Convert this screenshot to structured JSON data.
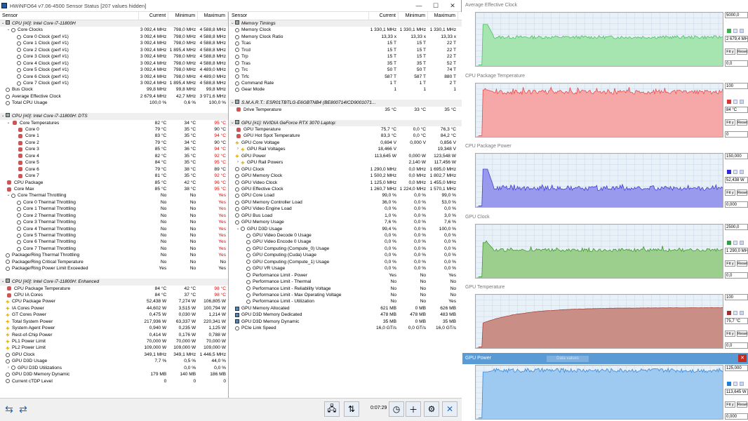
{
  "window": {
    "title": "HWiNFO64 v7.06-4500 Sensor Status [207 values hidden]",
    "minimize": "—",
    "maximize": "☐",
    "close": "✕"
  },
  "columns": {
    "sensor": "Sensor",
    "current": "Current",
    "minimum": "Minimum",
    "maximum": "Maximum"
  },
  "left_rows": [
    {
      "type": "group",
      "name": "CPU [#0]: Intel Core i7-11800H"
    },
    {
      "name": "Core Clocks",
      "icon": "clock",
      "exp": "⌄",
      "indent": 1,
      "cur": "3 092,4 MHz",
      "min": "798,0 MHz",
      "max": "4 588,8 MHz"
    },
    {
      "name": "Core 0 Clock (perf #1)",
      "icon": "clock",
      "indent": 2,
      "cur": "3 092,4 MHz",
      "min": "798,0 MHz",
      "max": "4 588,8 MHz"
    },
    {
      "name": "Core 1 Clock (perf #1)",
      "icon": "clock",
      "indent": 2,
      "cur": "3 092,4 MHz",
      "min": "798,0 MHz",
      "max": "4 588,8 MHz"
    },
    {
      "name": "Core 2 Clock (perf #1)",
      "icon": "clock",
      "indent": 2,
      "cur": "3 092,4 MHz",
      "min": "1 895,4 MHz",
      "max": "4 588,8 MHz"
    },
    {
      "name": "Core 3 Clock (perf #1)",
      "icon": "clock",
      "indent": 2,
      "cur": "3 092,4 MHz",
      "min": "798,0 MHz",
      "max": "4 588,8 MHz"
    },
    {
      "name": "Core 4 Clock (perf #1)",
      "icon": "clock",
      "indent": 2,
      "cur": "3 092,4 MHz",
      "min": "798,0 MHz",
      "max": "4 588,8 MHz"
    },
    {
      "name": "Core 5 Clock (perf #1)",
      "icon": "clock",
      "indent": 2,
      "cur": "3 092,4 MHz",
      "min": "798,0 MHz",
      "max": "4 489,0 MHz"
    },
    {
      "name": "Core 6 Clock (perf #1)",
      "icon": "clock",
      "indent": 2,
      "cur": "3 092,4 MHz",
      "min": "798,0 MHz",
      "max": "4 489,0 MHz"
    },
    {
      "name": "Core 7 Clock (perf #1)",
      "icon": "clock",
      "indent": 2,
      "cur": "3 092,4 MHz",
      "min": "1 895,4 MHz",
      "max": "4 588,8 MHz"
    },
    {
      "name": "Bus Clock",
      "icon": "clock",
      "indent": 0,
      "cur": "99,8 MHz",
      "min": "99,8 MHz",
      "max": "99,8 MHz"
    },
    {
      "name": "Average Effective Clock",
      "icon": "clock",
      "indent": 0,
      "cur": "2 679,4 MHz",
      "min": "42,7 MHz",
      "max": "3 971,6 MHz"
    },
    {
      "name": "Total CPU Usage",
      "icon": "clock",
      "indent": 0,
      "cur": "100,0 %",
      "min": "0,6 %",
      "max": "100,0 %"
    },
    {
      "type": "spacer"
    },
    {
      "type": "group",
      "name": "CPU [#0]: Intel Core i7-11800H: DTS"
    },
    {
      "name": "Core Temperatures",
      "icon": "therm",
      "exp": "⌄",
      "indent": 1,
      "cur": "82 °C",
      "min": "34 °C",
      "max": "95 °C",
      "maxred": true
    },
    {
      "name": "Core 0",
      "icon": "therm",
      "indent": 2,
      "cur": "79 °C",
      "min": "35 °C",
      "max": "90 °C"
    },
    {
      "name": "Core 1",
      "icon": "therm",
      "indent": 2,
      "cur": "83 °C",
      "min": "35 °C",
      "max": "94 °C",
      "maxred": true
    },
    {
      "name": "Core 2",
      "icon": "therm",
      "indent": 2,
      "cur": "79 °C",
      "min": "34 °C",
      "max": "90 °C"
    },
    {
      "name": "Core 3",
      "icon": "therm",
      "indent": 2,
      "cur": "85 °C",
      "min": "36 °C",
      "max": "94 °C",
      "maxred": true
    },
    {
      "name": "Core 4",
      "icon": "therm",
      "indent": 2,
      "cur": "82 °C",
      "min": "35 °C",
      "max": "92 °C",
      "maxred": true
    },
    {
      "name": "Core 5",
      "icon": "therm",
      "indent": 2,
      "cur": "84 °C",
      "min": "35 °C",
      "max": "95 °C",
      "maxred": true
    },
    {
      "name": "Core 6",
      "icon": "therm",
      "indent": 2,
      "cur": "79 °C",
      "min": "38 °C",
      "max": "89 °C"
    },
    {
      "name": "Core 7",
      "icon": "therm",
      "indent": 2,
      "cur": "81 °C",
      "min": "35 °C",
      "max": "92 °C",
      "maxred": true
    },
    {
      "name": "CPU Package",
      "icon": "therm",
      "indent": 0,
      "cur": "85 °C",
      "min": "42 °C",
      "max": "96 °C",
      "maxred": true
    },
    {
      "name": "Core Max",
      "icon": "therm",
      "indent": 0,
      "cur": "85 °C",
      "min": "38 °C",
      "max": "95 °C",
      "maxred": true
    },
    {
      "name": "Core Thermal Throttling",
      "icon": "clock",
      "exp": "⌄",
      "indent": 1,
      "cur": "No",
      "min": "No",
      "max": "Yes",
      "maxred": true
    },
    {
      "name": "Core 0 Thermal Throttling",
      "icon": "clock",
      "indent": 2,
      "cur": "No",
      "min": "No",
      "max": "Yes",
      "maxred": true
    },
    {
      "name": "Core 1 Thermal Throttling",
      "icon": "clock",
      "indent": 2,
      "cur": "No",
      "min": "No",
      "max": "Yes",
      "maxred": true
    },
    {
      "name": "Core 2 Thermal Throttling",
      "icon": "clock",
      "indent": 2,
      "cur": "No",
      "min": "No",
      "max": "Yes",
      "maxred": true
    },
    {
      "name": "Core 3 Thermal Throttling",
      "icon": "clock",
      "indent": 2,
      "cur": "No",
      "min": "No",
      "max": "Yes",
      "maxred": true
    },
    {
      "name": "Core 4 Thermal Throttling",
      "icon": "clock",
      "indent": 2,
      "cur": "No",
      "min": "No",
      "max": "Yes",
      "maxred": true
    },
    {
      "name": "Core 5 Thermal Throttling",
      "icon": "clock",
      "indent": 2,
      "cur": "No",
      "min": "No",
      "max": "Yes",
      "maxred": true
    },
    {
      "name": "Core 6 Thermal Throttling",
      "icon": "clock",
      "indent": 2,
      "cur": "No",
      "min": "No",
      "max": "Yes",
      "maxred": true
    },
    {
      "name": "Core 7 Thermal Throttling",
      "icon": "clock",
      "indent": 2,
      "cur": "No",
      "min": "No",
      "max": "Yes",
      "maxred": true
    },
    {
      "name": "Package/Ring Thermal Throttling",
      "icon": "clock",
      "indent": 0,
      "cur": "No",
      "min": "No",
      "max": "Yes",
      "maxred": true
    },
    {
      "name": "Package/Ring Critical Temperature",
      "icon": "clock",
      "indent": 0,
      "cur": "No",
      "min": "No",
      "max": "No"
    },
    {
      "name": "Package/Ring Power Limit Exceeded",
      "icon": "clock",
      "indent": 0,
      "cur": "Yes",
      "min": "No",
      "max": "Yes"
    },
    {
      "type": "spacer"
    },
    {
      "type": "group",
      "name": "CPU [#0]: Intel Core i7-11800H: Enhanced"
    },
    {
      "name": "CPU Package Temperature",
      "icon": "therm",
      "indent": 0,
      "cur": "84 °C",
      "min": "42 °C",
      "max": "98 °C",
      "maxred": true
    },
    {
      "name": "CPU IA Cores",
      "icon": "therm",
      "indent": 0,
      "cur": "84 °C",
      "min": "37 °C",
      "max": "98 °C",
      "maxred": true
    },
    {
      "name": "CPU Package Power",
      "icon": "bolt",
      "indent": 0,
      "cur": "52,438 W",
      "min": "7,274 W",
      "max": "106,805 W"
    },
    {
      "name": "IA Cores Power",
      "icon": "bolt",
      "indent": 0,
      "cur": "44,602 W",
      "min": "3,515 W",
      "max": "100,794 W"
    },
    {
      "name": "GT Cores Power",
      "icon": "bolt",
      "indent": 0,
      "cur": "0,475 W",
      "min": "0,030 W",
      "max": "1,214 W"
    },
    {
      "name": "Total System Power",
      "icon": "bolt",
      "indent": 0,
      "cur": "217,936 W",
      "min": "63,337 W",
      "max": "220,341 W"
    },
    {
      "name": "System Agent Power",
      "icon": "bolt",
      "indent": 0,
      "cur": "0,940 W",
      "min": "0,235 W",
      "max": "1,125 W"
    },
    {
      "name": "Rest-of-Chip Power",
      "icon": "bolt",
      "indent": 0,
      "cur": "0,414 W",
      "min": "0,176 W",
      "max": "0,788 W"
    },
    {
      "name": "PL1 Power Limit",
      "icon": "bolt",
      "indent": 0,
      "cur": "70,000 W",
      "min": "70,000 W",
      "max": "70,000 W"
    },
    {
      "name": "PL2 Power Limit",
      "icon": "bolt",
      "indent": 0,
      "cur": "109,000 W",
      "min": "109,000 W",
      "max": "109,000 W"
    },
    {
      "name": "GPU Clock",
      "icon": "clock",
      "indent": 0,
      "cur": "349,1 MHz",
      "min": "349,1 MHz",
      "max": "1 446,5 MHz"
    },
    {
      "name": "GPU D3D Usage",
      "icon": "clock",
      "indent": 0,
      "cur": "7,7 %",
      "min": "0,5 %",
      "max": "44,0 %"
    },
    {
      "name": "GPU D3D Utilizations",
      "icon": "clock",
      "exp": "›",
      "indent": 1,
      "cur": "",
      "min": "0,0 %",
      "max": "0,0 %"
    },
    {
      "name": "GPU D3D Memory Dynamic",
      "icon": "clock",
      "indent": 0,
      "cur": "179 MB",
      "min": "140 MB",
      "max": "186 MB"
    },
    {
      "name": "Current cTDP Level",
      "icon": "clock",
      "indent": 0,
      "cur": "0",
      "min": "0",
      "max": "0"
    }
  ],
  "right_rows": [
    {
      "type": "group",
      "name": "Memory Timings"
    },
    {
      "name": "Memory Clock",
      "icon": "clock",
      "indent": 0,
      "cur": "1 330,1 MHz",
      "min": "1 330,1 MHz",
      "max": "1 330,1 MHz"
    },
    {
      "name": "Memory Clock Ratio",
      "icon": "clock",
      "indent": 0,
      "cur": "13,33 x",
      "min": "13,33 x",
      "max": "13,33 x"
    },
    {
      "name": "Tcas",
      "icon": "clock",
      "indent": 0,
      "cur": "15 T",
      "min": "15 T",
      "max": "22 T"
    },
    {
      "name": "Trcd",
      "icon": "clock",
      "indent": 0,
      "cur": "15 T",
      "min": "15 T",
      "max": "22 T"
    },
    {
      "name": "Trp",
      "icon": "clock",
      "indent": 0,
      "cur": "15 T",
      "min": "15 T",
      "max": "22 T"
    },
    {
      "name": "Tras",
      "icon": "clock",
      "indent": 0,
      "cur": "35 T",
      "min": "35 T",
      "max": "52 T"
    },
    {
      "name": "Trc",
      "icon": "clock",
      "indent": 0,
      "cur": "50 T",
      "min": "50 T",
      "max": "74 T"
    },
    {
      "name": "Trfc",
      "icon": "clock",
      "indent": 0,
      "cur": "587 T",
      "min": "587 T",
      "max": "880 T"
    },
    {
      "name": "Command Rate",
      "icon": "clock",
      "indent": 0,
      "cur": "1 T",
      "min": "1 T",
      "max": "2 T"
    },
    {
      "name": "Gear Mode",
      "icon": "clock",
      "indent": 0,
      "cur": "1",
      "min": "1",
      "max": "1"
    },
    {
      "type": "spacer"
    },
    {
      "type": "group",
      "name": "S.M.A.R.T.: ESR01TBTLG-E6GBTNB4 (BE800714ICD9001071..."
    },
    {
      "name": "Drive Temperature",
      "icon": "therm",
      "indent": 0,
      "cur": "35 °C",
      "min": "33 °C",
      "max": "35 °C"
    },
    {
      "type": "spacer"
    },
    {
      "type": "group",
      "name": "GPU [#1]: NVIDIA GeForce RTX 3070 Laptop:"
    },
    {
      "name": "GPU Temperature",
      "icon": "therm",
      "indent": 0,
      "cur": "75,7 °C",
      "min": "0,0 °C",
      "max": "76,3 °C"
    },
    {
      "name": "GPU Hot Spot Temperature",
      "icon": "therm",
      "indent": 0,
      "cur": "83,3 °C",
      "min": "0,0 °C",
      "max": "84,2 °C"
    },
    {
      "name": "GPU Core Voltage",
      "icon": "bolt",
      "indent": 0,
      "cur": "0,694 V",
      "min": "0,000 V",
      "max": "0,856 V"
    },
    {
      "name": "GPU Rail Voltages",
      "icon": "bolt",
      "exp": "›",
      "indent": 1,
      "cur": "18,466 V",
      "min": "",
      "max": "19,348 V"
    },
    {
      "name": "GPU Power",
      "icon": "bolt",
      "indent": 0,
      "cur": "113,645 W",
      "min": "0,000 W",
      "max": "123,548 W"
    },
    {
      "name": "GPU Rail Powers",
      "icon": "bolt",
      "exp": "›",
      "indent": 1,
      "cur": "",
      "min": "2,140 W",
      "max": "117,456 W"
    },
    {
      "name": "GPU Clock",
      "icon": "clock",
      "indent": 0,
      "cur": "1 290,0 MHz",
      "min": "0,0 MHz",
      "max": "1 695,0 MHz"
    },
    {
      "name": "GPU Memory Clock",
      "icon": "clock",
      "indent": 0,
      "cur": "1 500,2 MHz",
      "min": "0,0 MHz",
      "max": "1 802,7 MHz"
    },
    {
      "name": "GPU Video Clock",
      "icon": "clock",
      "indent": 0,
      "cur": "1 125,0 MHz",
      "min": "0,0 MHz",
      "max": "1 455,0 MHz"
    },
    {
      "name": "GPU Effective Clock",
      "icon": "clock",
      "indent": 0,
      "cur": "1 260,7 MHz",
      "min": "1 224,0 MHz",
      "max": "1 570,1 MHz"
    },
    {
      "name": "GPU Core Load",
      "icon": "clock",
      "indent": 0,
      "cur": "99,0 %",
      "min": "0,0 %",
      "max": "99,0 %"
    },
    {
      "name": "GPU Memory Controller Load",
      "icon": "clock",
      "indent": 0,
      "cur": "36,0 %",
      "min": "0,0 %",
      "max": "53,0 %"
    },
    {
      "name": "GPU Video Engine Load",
      "icon": "clock",
      "indent": 0,
      "cur": "0,0 %",
      "min": "0,0 %",
      "max": "0,0 %"
    },
    {
      "name": "GPU Bus Load",
      "icon": "clock",
      "indent": 0,
      "cur": "1,0 %",
      "min": "0,0 %",
      "max": "3,0 %"
    },
    {
      "name": "GPU Memory Usage",
      "icon": "clock",
      "indent": 0,
      "cur": "7,6 %",
      "min": "0,0 %",
      "max": "7,6 %"
    },
    {
      "name": "GPU D3D Usage",
      "icon": "clock",
      "exp": "⌄",
      "indent": 1,
      "cur": "99,4 %",
      "min": "0,0 %",
      "max": "100,0 %"
    },
    {
      "name": "GPU Video Decode 0 Usage",
      "icon": "clock",
      "indent": 2,
      "cur": "0,0 %",
      "min": "0,0 %",
      "max": "0,0 %"
    },
    {
      "name": "GPU Video Encode 0 Usage",
      "icon": "clock",
      "indent": 2,
      "cur": "0,0 %",
      "min": "0,0 %",
      "max": "0,0 %"
    },
    {
      "name": "GPU Computing (Compute_0) Usage",
      "icon": "clock",
      "indent": 2,
      "cur": "0,0 %",
      "min": "0,0 %",
      "max": "0,0 %"
    },
    {
      "name": "GPU Computing (Cuda) Usage",
      "icon": "clock",
      "indent": 2,
      "cur": "0,0 %",
      "min": "0,0 %",
      "max": "0,0 %"
    },
    {
      "name": "GPU Computing (Compute_1) Usage",
      "icon": "clock",
      "indent": 2,
      "cur": "0,0 %",
      "min": "0,0 %",
      "max": "0,0 %"
    },
    {
      "name": "GPU VR Usage",
      "icon": "clock",
      "indent": 2,
      "cur": "0,0 %",
      "min": "0,0 %",
      "max": "0,0 %"
    },
    {
      "name": "Performance Limit - Power",
      "icon": "clock",
      "indent": 2,
      "cur": "Yes",
      "min": "No",
      "max": "Yes"
    },
    {
      "name": "Performance Limit - Thermal",
      "icon": "clock",
      "indent": 2,
      "cur": "No",
      "min": "No",
      "max": "No"
    },
    {
      "name": "Performance Limit - Reliability Voltage",
      "icon": "clock",
      "indent": 2,
      "cur": "No",
      "min": "No",
      "max": "No"
    },
    {
      "name": "Performance Limit - Max Operating Voltage",
      "icon": "clock",
      "indent": 2,
      "cur": "No",
      "min": "No",
      "max": "No"
    },
    {
      "name": "Performance Limit - Utilization",
      "icon": "clock",
      "indent": 2,
      "cur": "No",
      "min": "No",
      "max": "Yes"
    },
    {
      "name": "GPU Memory Allocated",
      "icon": "mem",
      "indent": 0,
      "cur": "621 MB",
      "min": "0 MB",
      "max": "626 MB"
    },
    {
      "name": "GPU D3D Memory Dedicated",
      "icon": "mem",
      "indent": 0,
      "cur": "478 MB",
      "min": "478 MB",
      "max": "483 MB"
    },
    {
      "name": "GPU D3D Memory Dynamic",
      "icon": "mem",
      "indent": 0,
      "cur": "35 MB",
      "min": "0 MB",
      "max": "35 MB"
    },
    {
      "name": "PCIe Link Speed",
      "icon": "clock",
      "indent": 0,
      "cur": "16,0 GT/s",
      "min": "0,0 GT/s",
      "max": "16,0 GT/s"
    }
  ],
  "toolbar": {
    "timer": "0:07:29",
    "prev_icon": "arrows-left-icon",
    "next_icon": "arrows-right-icon"
  },
  "graphs": [
    {
      "title": "Average Effective Clock",
      "max": "5000,0",
      "current": "2 679,4 MHz",
      "min": "0,0",
      "color": "#a6e5b0",
      "line": "#4fbf66",
      "sq": "#37b24d",
      "level": 0.54,
      "start": 0.78,
      "noise": 0.03,
      "spiky": false,
      "fit": "Fit y",
      "reset": "Reset"
    },
    {
      "title": "CPU Package Temperature",
      "max": "100",
      "current": "84 °C",
      "min": "0",
      "color": "#f6a7a7",
      "line": "#e84a4a",
      "sq": "#e03131",
      "level": 0.84,
      "start": 0.88,
      "noise": 0.04,
      "spiky": true,
      "fit": "Fit y",
      "reset": "Reset"
    },
    {
      "title": "CPU Package Power",
      "max": "150,000",
      "current": "52,438 W",
      "min": "0,000",
      "color": "#9999ee",
      "line": "#4040d0",
      "sq": "#2b2bd6",
      "level": 0.35,
      "start": 0.71,
      "noise": 0.04,
      "spiky": true,
      "fit": "Fit y",
      "reset": "Reset"
    },
    {
      "title": "GPU Clock",
      "max": "2500,0",
      "current": "1 290,0 MHz",
      "min": "0,0",
      "color": "#9ccf8e",
      "line": "#3c9a2c",
      "sq": "#2f9e44",
      "level": 0.52,
      "start": 0.66,
      "noise": 0.03,
      "spiky": true,
      "fit": "Fit y",
      "reset": "Reset"
    },
    {
      "title": "GPU Temperature",
      "max": "100",
      "current": "75,7 °C",
      "min": "0,0",
      "color": "#c98f86",
      "line": "#a8443a",
      "sq": "#a52a2a",
      "level": 0.757,
      "start": 0.47,
      "noise": 0.005,
      "spiky": false,
      "curve": true,
      "fit": "Fit y",
      "reset": "Reset"
    },
    {
      "title": "GPU Power",
      "max": "125,000",
      "current": "113,645 W",
      "min": "0,000",
      "color": "#9ec9f0",
      "line": "#3a86d6",
      "sq": "#1c7ed6",
      "level": 0.91,
      "start": 0.88,
      "noise": 0.04,
      "spiky": false,
      "active": true,
      "ghost": "Data values",
      "fit": "Fit y",
      "reset": "Reset"
    }
  ]
}
